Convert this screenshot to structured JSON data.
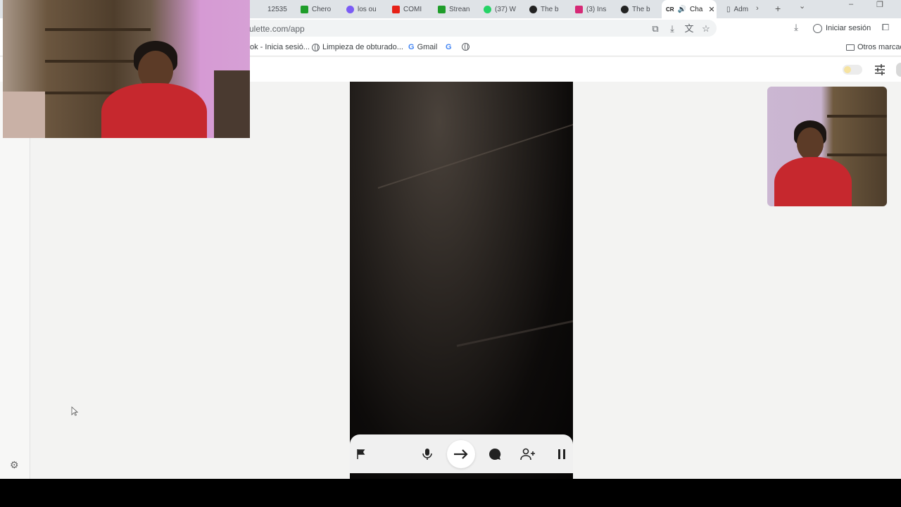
{
  "browser": {
    "tabs": [
      {
        "title": "12535",
        "color": "#dfe3e7"
      },
      {
        "title": "Chero",
        "color": "#1f9d2a"
      },
      {
        "title": "los ou",
        "color": "#7b5cf5"
      },
      {
        "title": "COMI",
        "color": "#e62117"
      },
      {
        "title": "Strean",
        "color": "#1f9d2a"
      },
      {
        "title": "(37) W",
        "color": "#25d366"
      },
      {
        "title": "The b",
        "color": "#222222"
      },
      {
        "title": "(3) Ins",
        "color": "#d62976"
      },
      {
        "title": "The b",
        "color": "#222222"
      }
    ],
    "active_tab": {
      "badge": "CR",
      "title": "Cha",
      "close": "✕"
    },
    "extra_tab": {
      "title": "Adm"
    },
    "url": "ulette.com/app",
    "signin_label": "Iniciar sesión",
    "bookmarks": [
      {
        "label": "ok - Inicia sesió...",
        "icon": "none"
      },
      {
        "label": "Limpieza de obturado...",
        "icon": "globe-icon"
      },
      {
        "label": "Gmail",
        "icon": "google-icon"
      },
      {
        "label": "",
        "icon": "google-icon"
      },
      {
        "label": "",
        "icon": "globe-icon"
      }
    ],
    "other_bookmarks": "Otros marcad"
  },
  "app": {
    "controls": [
      "flag-icon",
      "microphone-icon",
      "next-arrow-icon",
      "chat-icon",
      "add-friend-icon",
      "pause-icon"
    ],
    "theme_toggle": "light",
    "accent": "#333333"
  }
}
